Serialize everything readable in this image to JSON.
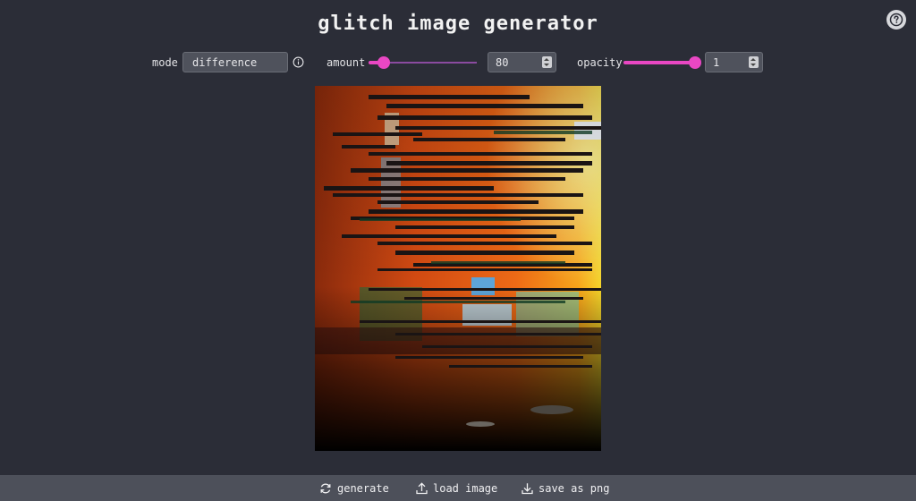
{
  "app": {
    "title": "glitch image generator"
  },
  "controls": {
    "mode": {
      "label": "mode",
      "value": "difference"
    },
    "amount": {
      "label": "amount",
      "value": "80",
      "fraction": 0.14
    },
    "opacity": {
      "label": "opacity",
      "value": "1",
      "fraction": 1.0
    }
  },
  "footer": {
    "generate": "generate",
    "load": "load image",
    "save": "save as png"
  },
  "icons": {
    "help": "question-circle-icon",
    "info": "info-circle-icon",
    "generate": "refresh-icon",
    "load": "upload-icon",
    "save": "download-icon"
  },
  "colors": {
    "background": "#2b2d37",
    "accent": "#e947c3",
    "input_bg": "#4f525c",
    "footer_bg": "#4d505a"
  }
}
